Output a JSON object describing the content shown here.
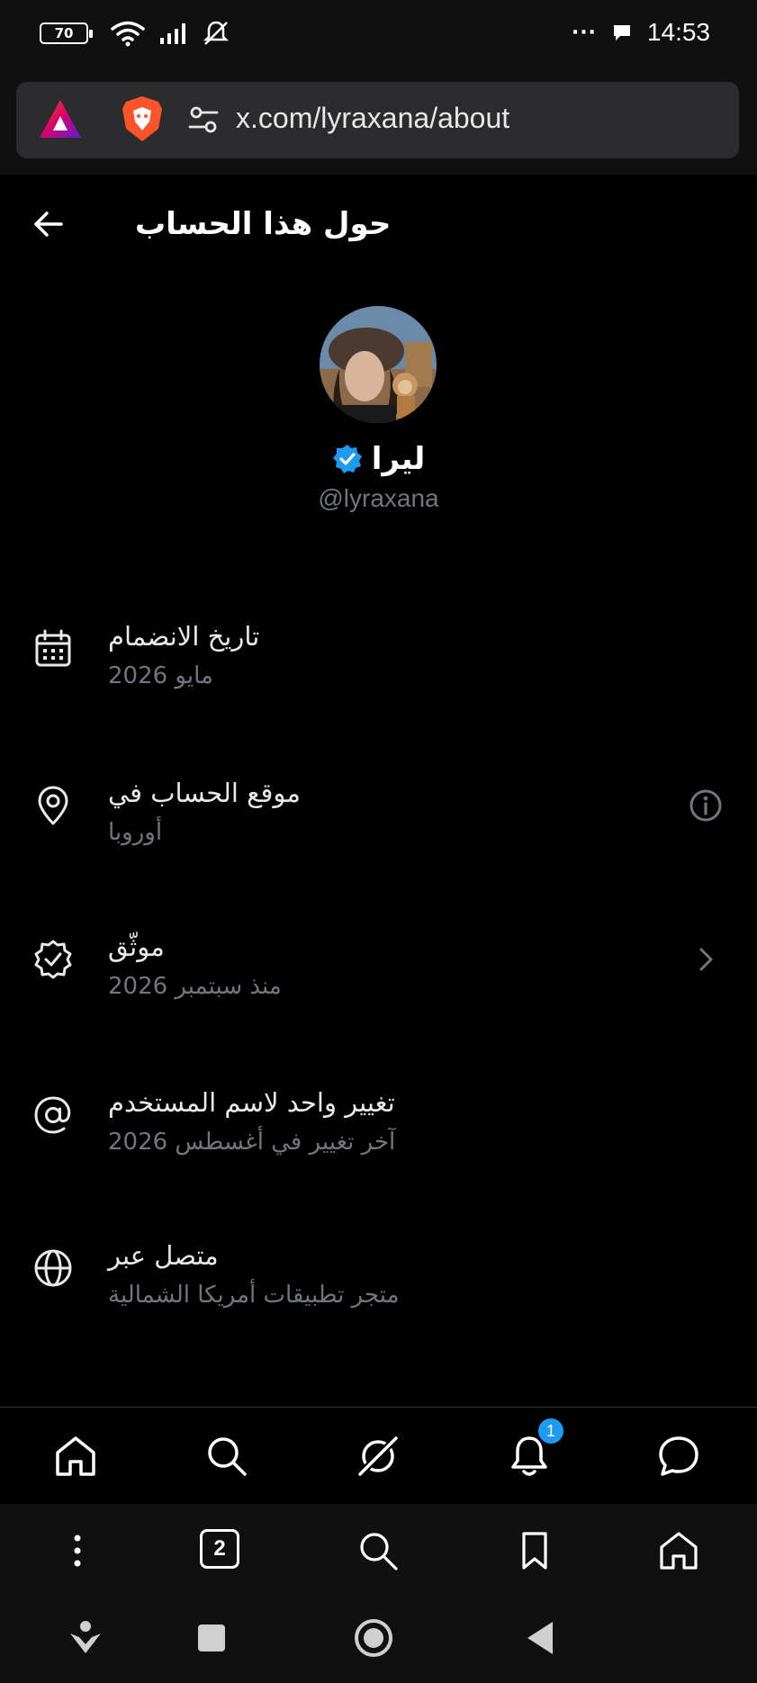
{
  "status_bar": {
    "battery": "70",
    "more": "···",
    "time": "14:53"
  },
  "browser": {
    "url": "x.com/lyraxana/about"
  },
  "header": {
    "title": "حول هذا الحساب"
  },
  "profile": {
    "name": "ليرا",
    "handle": "@lyraxana",
    "verified": true
  },
  "items": [
    {
      "icon": "calendar-icon",
      "title": "تاريخ الانضمام",
      "subtitle": "مايو 2026"
    },
    {
      "icon": "location-pin-icon",
      "title": "موقع الحساب في",
      "subtitle": "أوروبا",
      "right_icon": "info-icon"
    },
    {
      "icon": "verified-badge-icon",
      "title": "موثّق",
      "subtitle": "منذ سبتمبر 2026",
      "right_icon": "chevron-right-icon"
    },
    {
      "icon": "at-sign-icon",
      "title": "تغيير واحد لاسم المستخدم",
      "subtitle": "آخر تغيير في أغسطس 2026"
    },
    {
      "icon": "globe-icon",
      "title": "متصل عبر",
      "subtitle": "متجر تطبيقات أمريكا الشمالية"
    }
  ],
  "tab_bar": {
    "notifications_badge": "1"
  },
  "browser_bottom": {
    "tab_count": "2"
  },
  "colors": {
    "background": "#000000",
    "secondary_text": "#71767b",
    "accent": "#1d9bf0"
  }
}
